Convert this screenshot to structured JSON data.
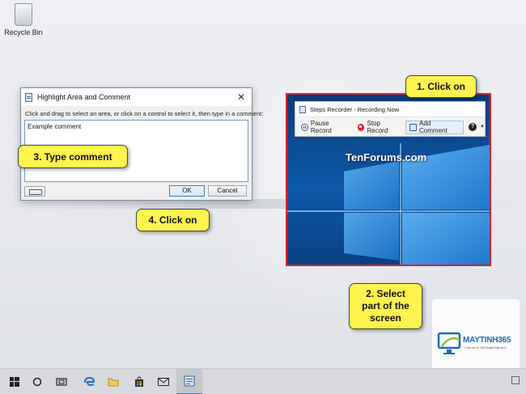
{
  "desktop": {
    "recycle_bin_label": "Recycle Bin"
  },
  "dialog": {
    "title": "Highlight Area and Comment",
    "close": "✕",
    "instruction": "Click and drag to select an area, or click on a control to select it, then type in a comment:",
    "comment_value": "Example comment",
    "ok_label": "OK",
    "cancel_label": "Cancel"
  },
  "steps_recorder": {
    "title": "Steps Recorder - Recording Now",
    "pause_label": "Pause Record",
    "stop_label": "Stop Record",
    "add_comment_label": "Add Comment",
    "help_glyph": "?",
    "caret": "▼"
  },
  "screenshot": {
    "watermark": "TenForums.com"
  },
  "callouts": {
    "step1": "1. Click on",
    "step2_line1": "2. Select",
    "step2_line2": "part of the",
    "step2_line3": "screen",
    "step3": "3. Type comment",
    "step4": "4. Click on"
  },
  "logo": {
    "name": "MAYTINH365",
    "tagline": "Chia sẻ & Thủ thuật Máy tính"
  },
  "colors": {
    "callout_fill": "#fff34d",
    "region_border": "#d8262d",
    "accent_blue": "#1b6bb3"
  }
}
